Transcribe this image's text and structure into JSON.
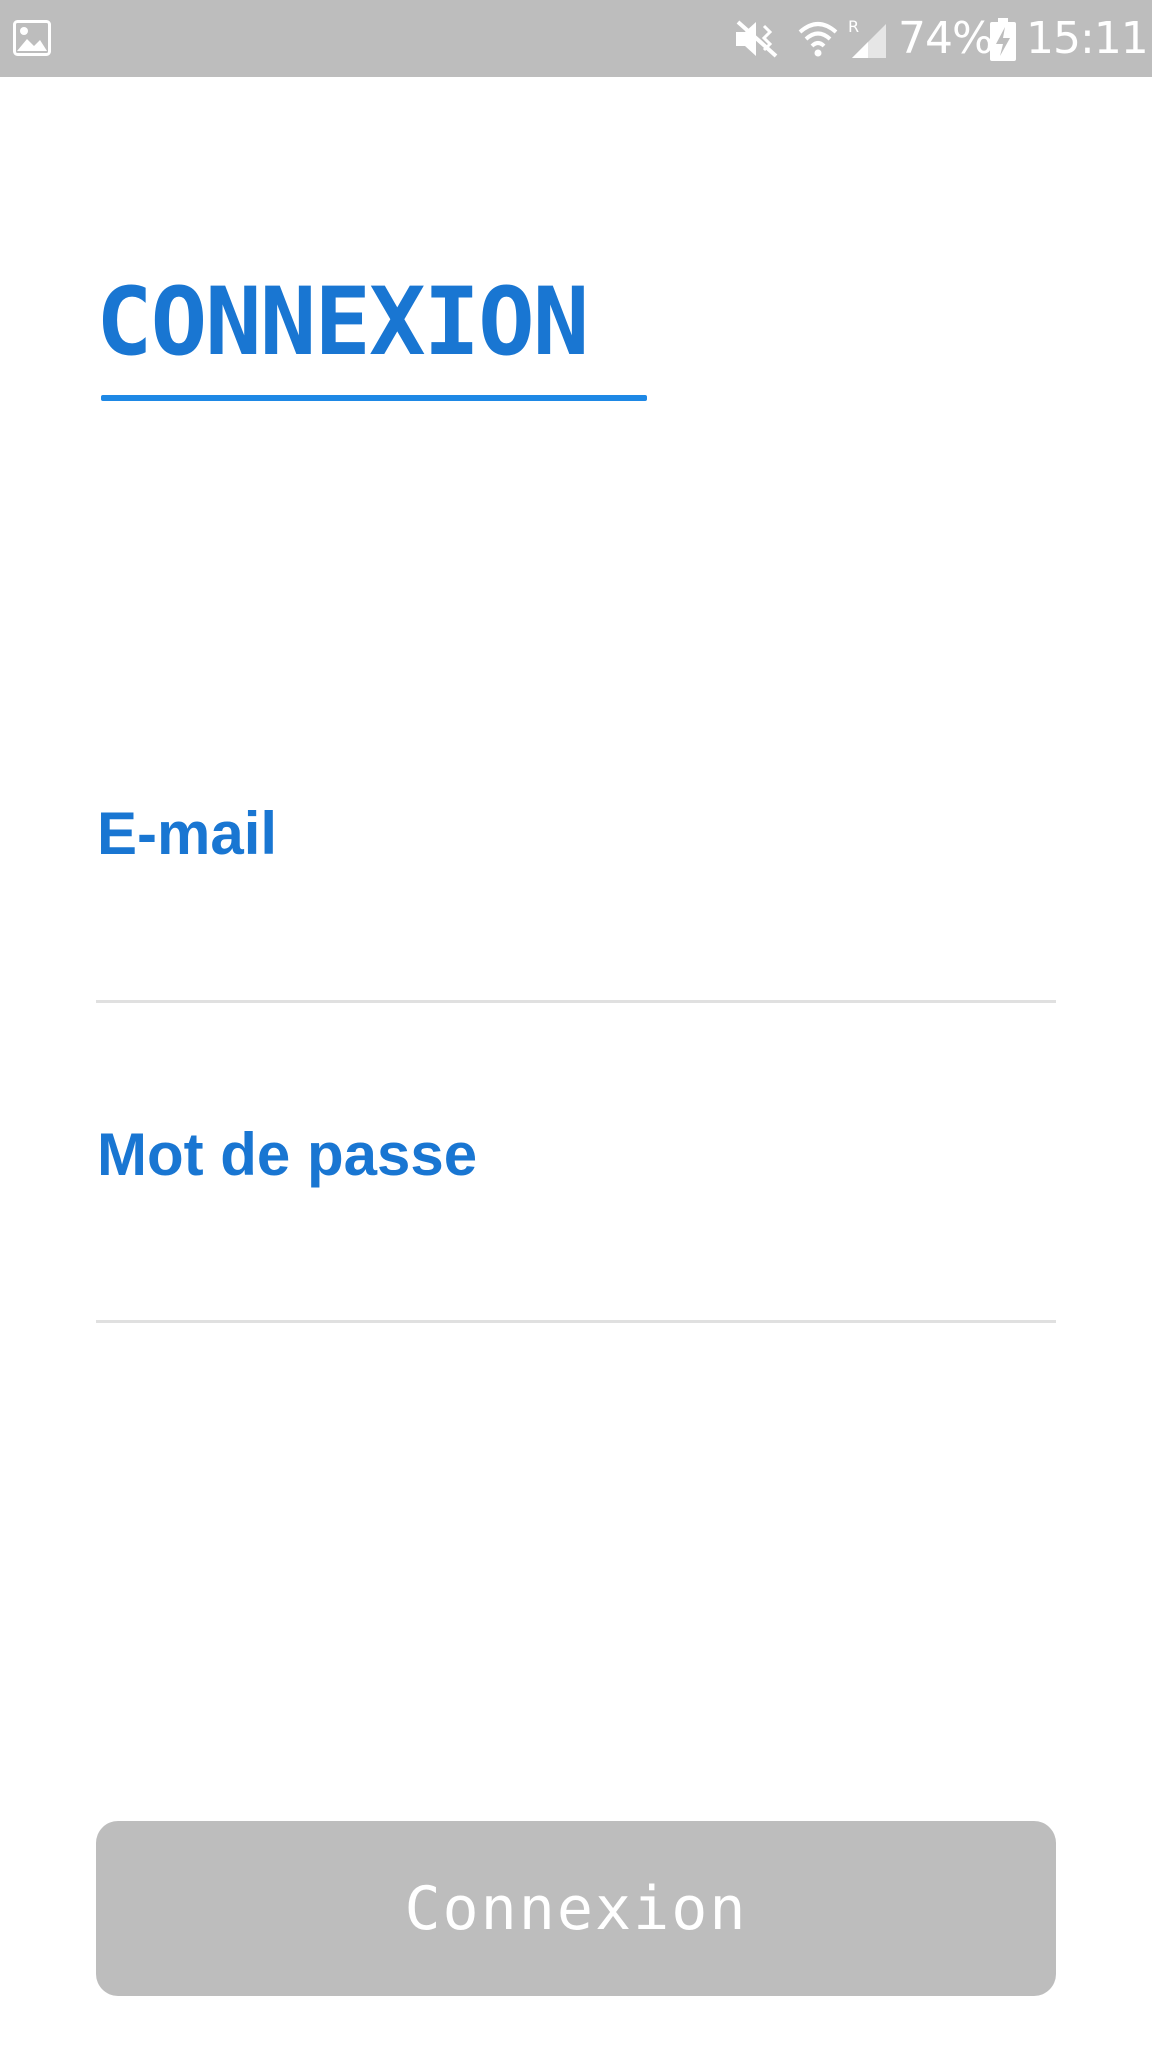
{
  "status_bar": {
    "battery_percent": "74%",
    "time": "15:11",
    "icons": [
      "image-icon",
      "mute-icon",
      "wifi-icon",
      "signal-icon",
      "battery-charging-icon"
    ]
  },
  "login": {
    "title": "CONNEXION",
    "email_label": "E-mail",
    "email_value": "",
    "password_label": "Mot de passe",
    "password_value": "",
    "submit_label": "Connexion",
    "submit_enabled": false
  },
  "colors": {
    "accent": "#1976d2",
    "underline": "#1e88e5",
    "status_bar": "#bdbdbd",
    "button_disabled": "#bdbdbd",
    "input_line": "#e0e0e0"
  }
}
